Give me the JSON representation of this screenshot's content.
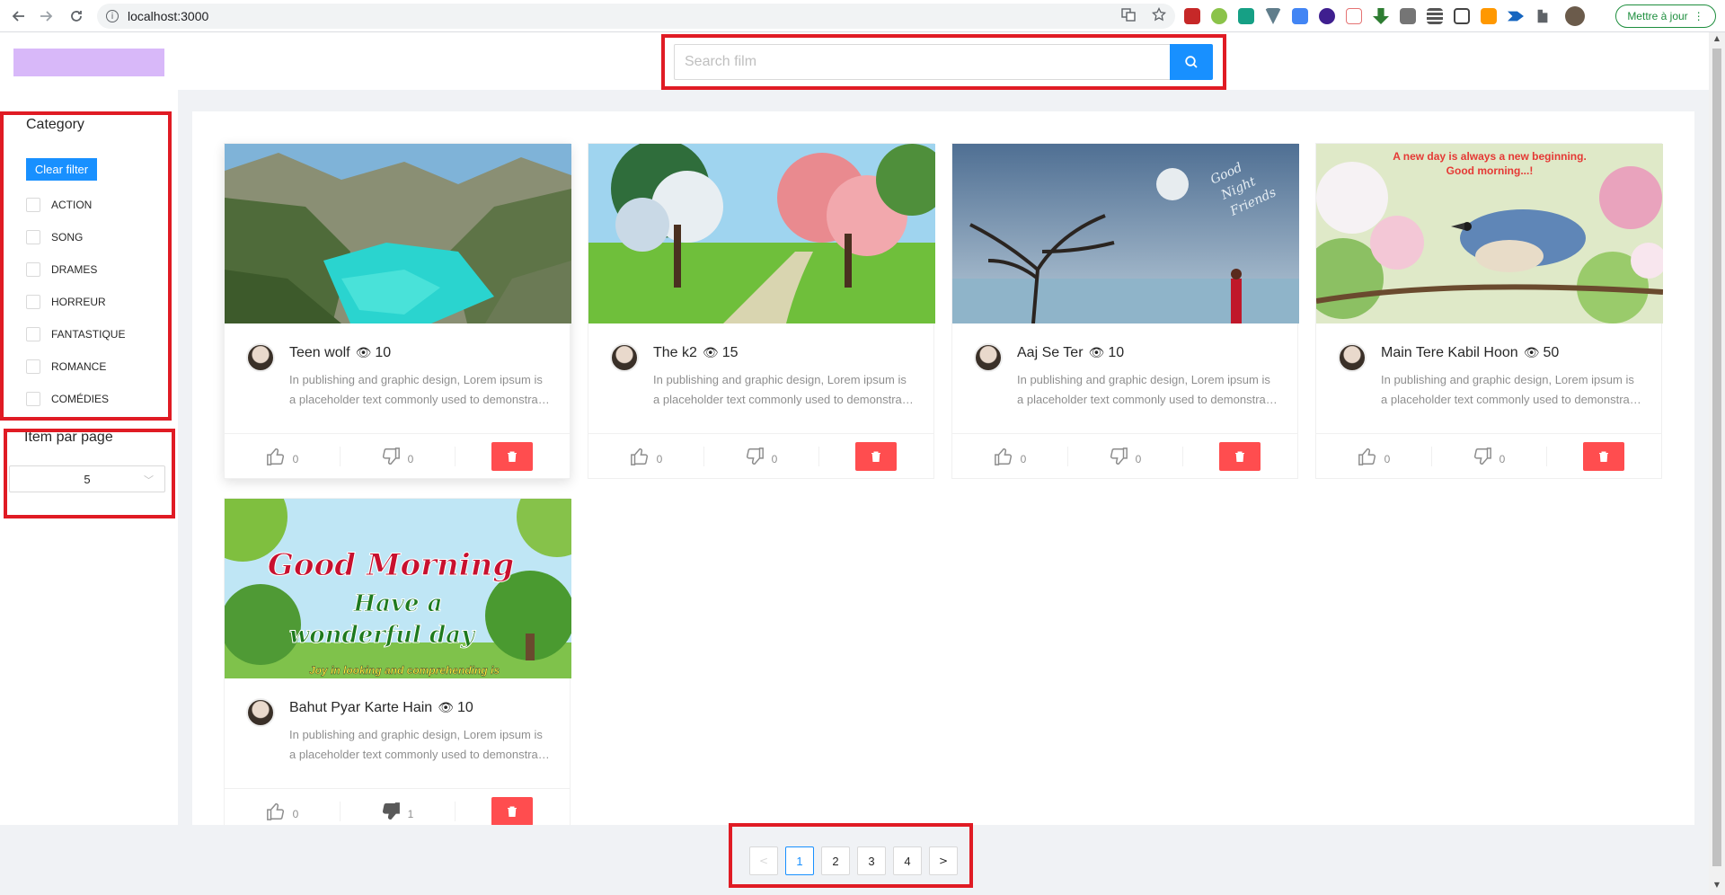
{
  "browser": {
    "url": "localhost:3000",
    "update_label": "Mettre à jour",
    "info_glyph": "i"
  },
  "search": {
    "placeholder": "Search film"
  },
  "sidebar": {
    "category_title": "Category",
    "clear_filter_label": "Clear filter",
    "categories": [
      {
        "label": "ACTION",
        "checked": false
      },
      {
        "label": "SONG",
        "checked": false
      },
      {
        "label": "DRAMES",
        "checked": false
      },
      {
        "label": "HORREUR",
        "checked": false
      },
      {
        "label": "FANTASTIQUE",
        "checked": false
      },
      {
        "label": "ROMANCE",
        "checked": false
      },
      {
        "label": "COMÉDIES",
        "checked": false
      }
    ],
    "items_per_page_title": "Item par page",
    "items_per_page_value": "5"
  },
  "films": [
    {
      "title": "Teen wolf",
      "views": "10",
      "description": "In publishing and graphic design, Lorem ipsum is a placeholder text commonly used to demonstrate the visual form of a document",
      "likes": "0",
      "dislikes": "0",
      "image": "canyon"
    },
    {
      "title": "The k2",
      "views": "15",
      "description": "In publishing and graphic design, Lorem ipsum is a placeholder text commonly used to demonstrate the visual form of a document",
      "likes": "0",
      "dislikes": "0",
      "image": "blossom-trees"
    },
    {
      "title": "Aaj Se Ter",
      "views": "10",
      "description": "In publishing and graphic design, Lorem ipsum is a placeholder text commonly used to demonstrate the visual form of a document",
      "likes": "0",
      "dislikes": "0",
      "image": "good-night"
    },
    {
      "title": "Main Tere Kabil Hoon",
      "views": "50",
      "description": "In publishing and graphic design, Lorem ipsum is a placeholder text commonly used to demonstrate the visual form of a document",
      "likes": "0",
      "dislikes": "0",
      "image": "bird-blossom"
    },
    {
      "title": "Bahut Pyar Karte Hain",
      "views": "10",
      "description": "In publishing and graphic design, Lorem ipsum is a placeholder text commonly used to demonstrate the visual form of a document",
      "likes": "0",
      "dislikes": "1",
      "image": "good-morning"
    }
  ],
  "image_text": {
    "good_night_1": "Good",
    "good_night_2": "Night",
    "good_night_3": "Friends",
    "bird_line_1": "A new day is always a new beginning.",
    "bird_line_2": "Good morning...!",
    "gm_line_1": "Good Morning",
    "gm_line_2": "Have a",
    "gm_line_3": "wonderful day",
    "gm_line_4": "Joy in looking and comprehending is"
  },
  "pagination": {
    "prev": "<",
    "next": ">",
    "pages": [
      "1",
      "2",
      "3",
      "4"
    ],
    "current": "1"
  },
  "colors": {
    "primary": "#1890ff",
    "danger": "#ff4d4f",
    "logo": "#d8b8f9",
    "highlight": "#e01b24"
  }
}
